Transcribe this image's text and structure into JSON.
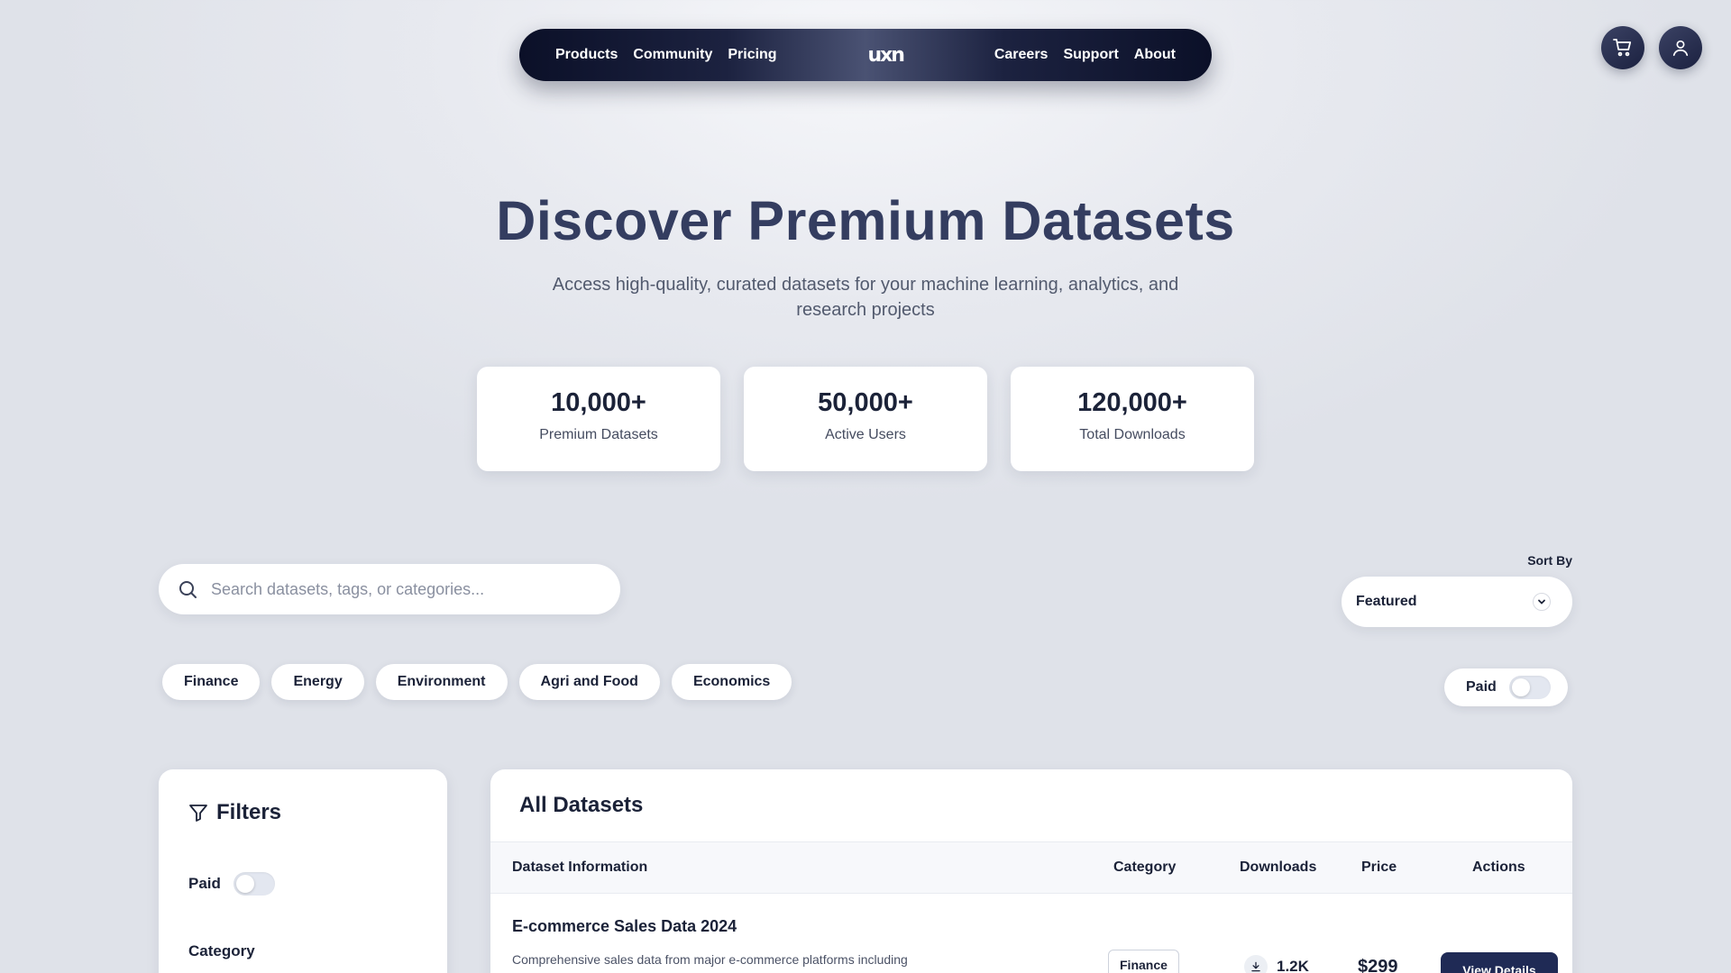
{
  "nav": {
    "left_links": [
      "Products",
      "Community",
      "Pricing"
    ],
    "logo": "uxn",
    "right_links": [
      "Careers",
      "Support",
      "About"
    ]
  },
  "header_actions": {
    "cart_icon": "cart-icon",
    "user_icon": "user-icon"
  },
  "hero": {
    "title": "Discover Premium Datasets",
    "subtitle": "Access high-quality, curated datasets for your machine learning, analytics, and research projects"
  },
  "stats": [
    {
      "value": "10,000+",
      "label": "Premium Datasets"
    },
    {
      "value": "50,000+",
      "label": "Active Users"
    },
    {
      "value": "120,000+",
      "label": "Total Downloads"
    }
  ],
  "search": {
    "placeholder": "Search datasets, tags, or categories...",
    "value": ""
  },
  "sort": {
    "label": "Sort By",
    "selected": "Featured"
  },
  "chips": [
    "Finance",
    "Energy",
    "Environment",
    "Agri and Food",
    "Economics"
  ],
  "paid_toggle": {
    "label": "Paid",
    "on": false
  },
  "filters": {
    "title": "Filters",
    "paid_label": "Paid",
    "category_label": "Category"
  },
  "datasets": {
    "title": "All Datasets",
    "columns": [
      "Dataset Information",
      "Category",
      "Downloads",
      "Price",
      "Actions"
    ],
    "rows": [
      {
        "title": "E-commerce Sales Data 2024",
        "description": "Comprehensive sales data from major e-commerce platforms including",
        "category": "Finance",
        "downloads": "1.2K",
        "price": "$299",
        "action": "View Details"
      }
    ]
  },
  "colors": {
    "primary": "#1f2a55",
    "hero_title": "#343d60",
    "nav_dark": "#0b1028"
  }
}
